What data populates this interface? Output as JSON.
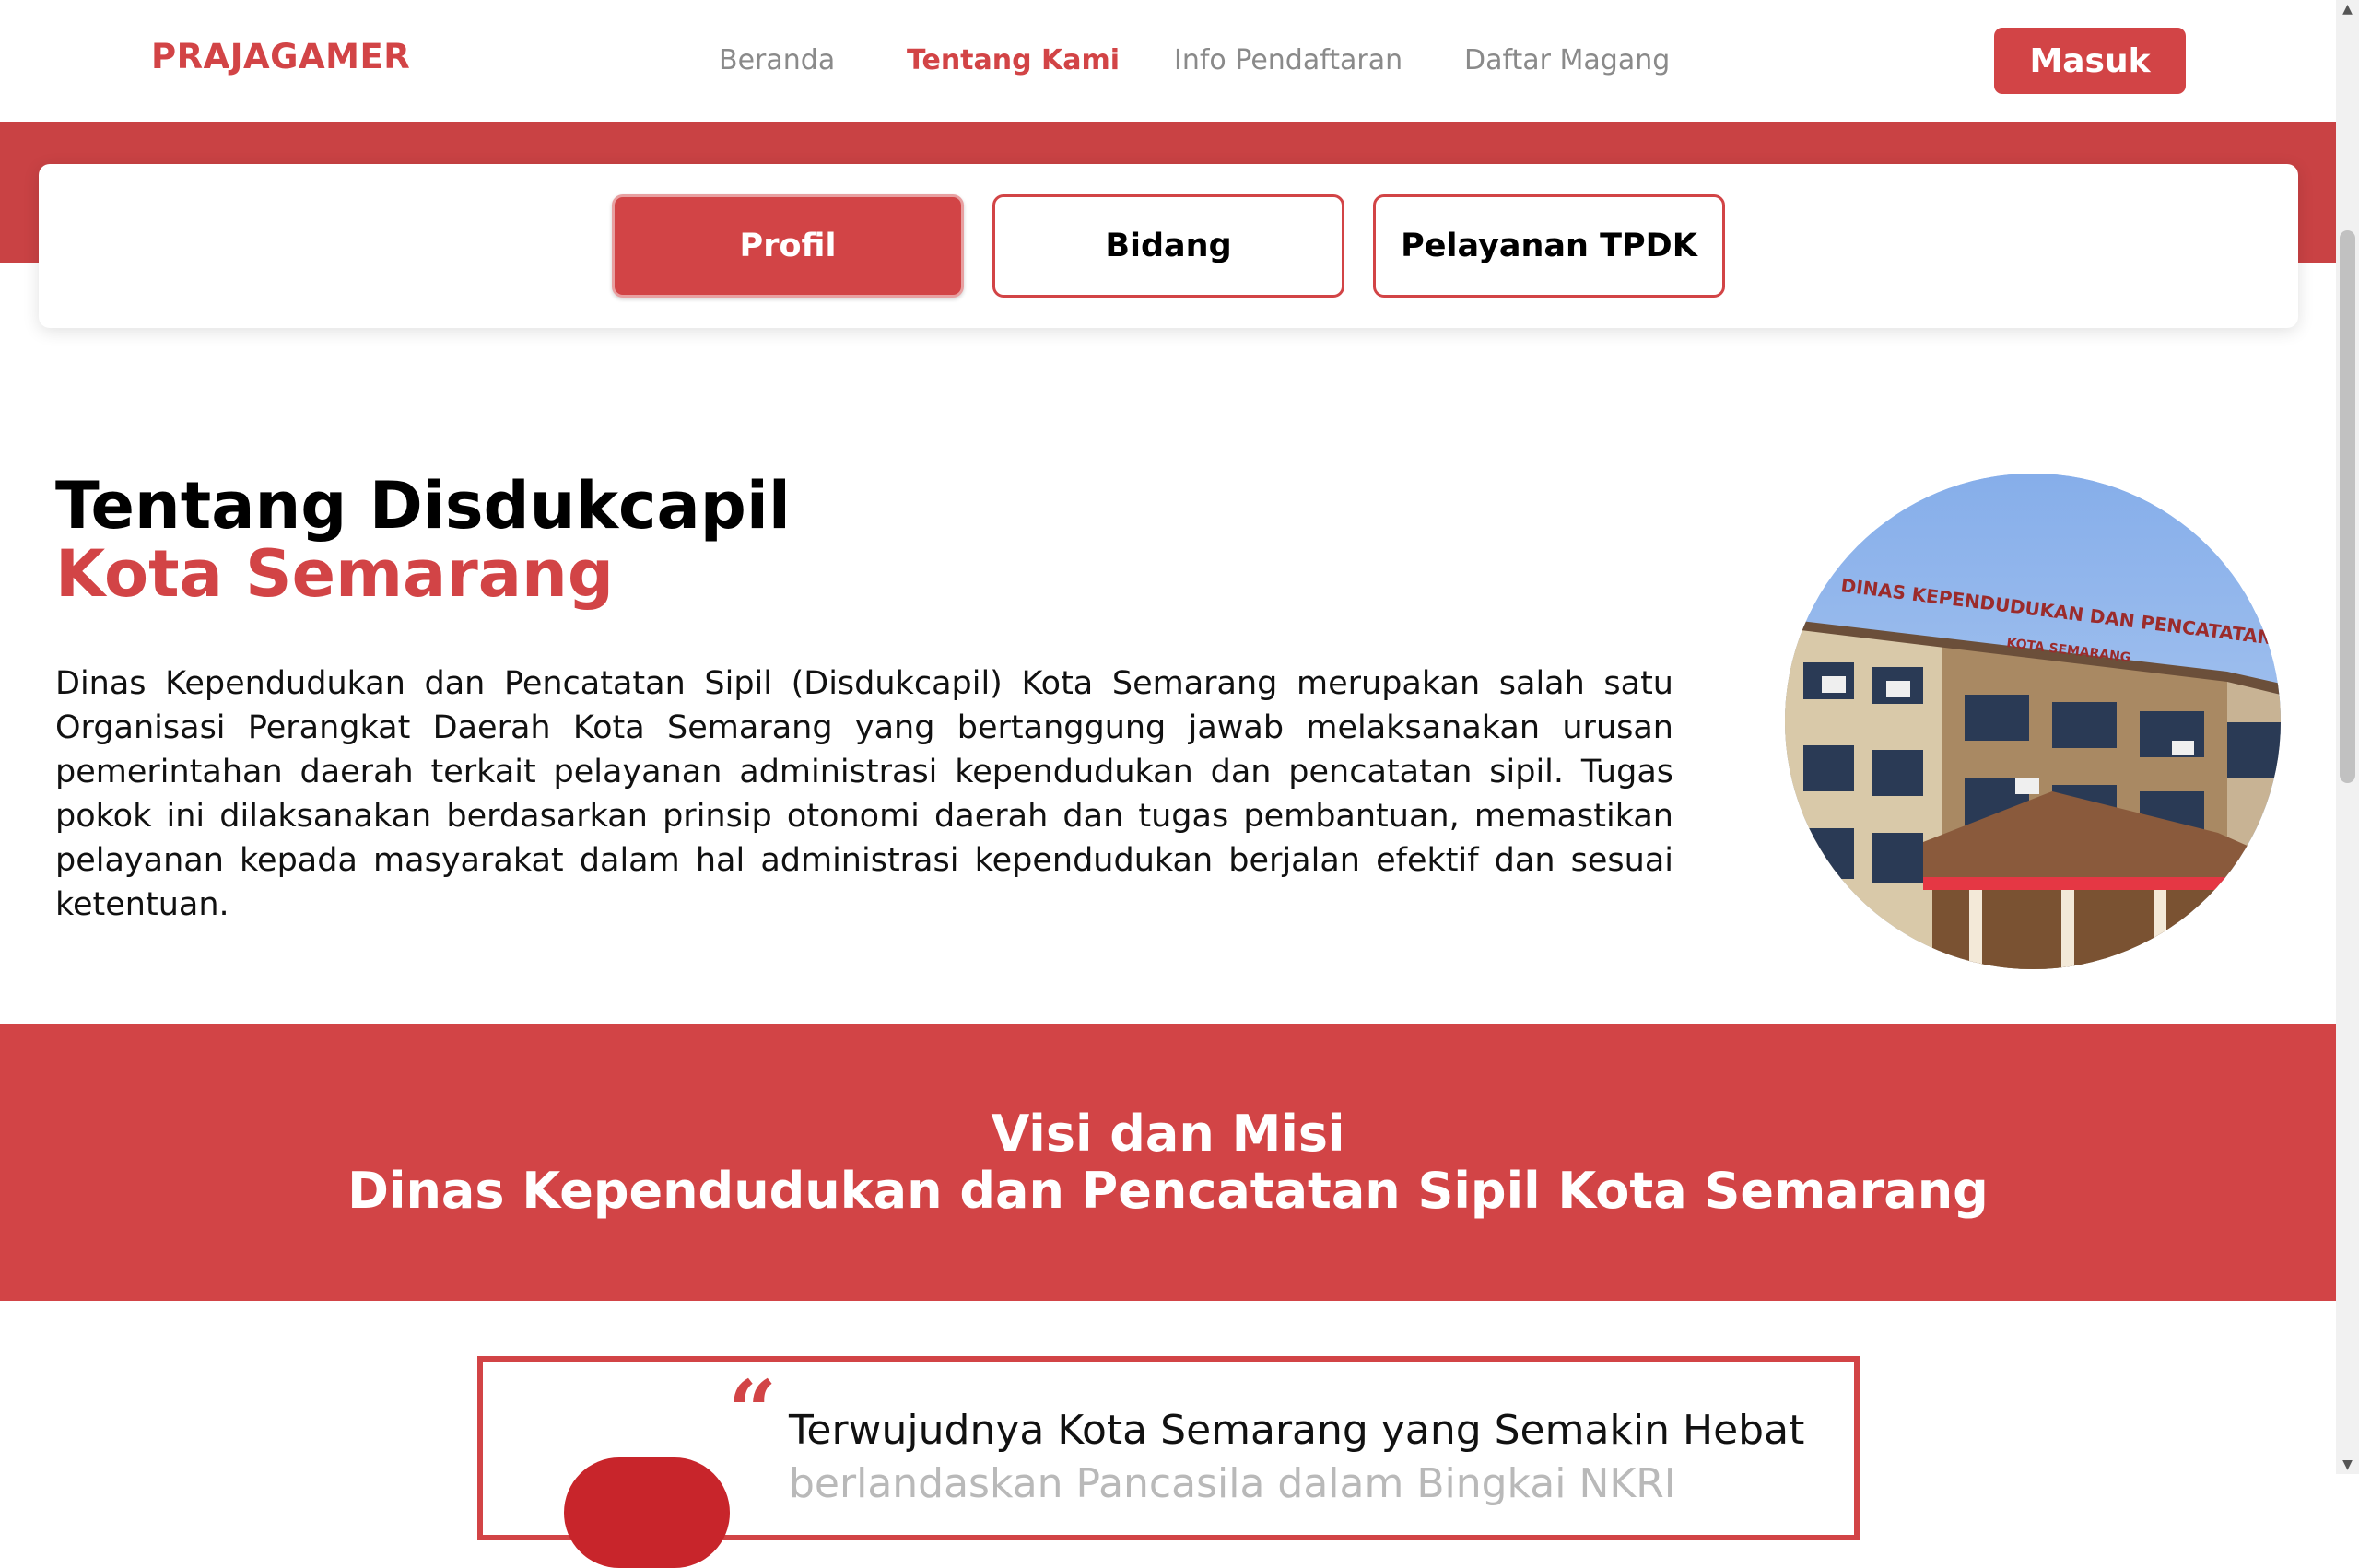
{
  "navbar": {
    "brand": "PRAJAGAMER",
    "links": [
      "Beranda",
      "Tentang Kami",
      "Info Pendaftaran",
      "Daftar Magang"
    ],
    "active": "Tentang Kami",
    "login_label": "Masuk"
  },
  "tabs": [
    {
      "label": "Profil",
      "active": true
    },
    {
      "label": "Bidang",
      "active": false
    },
    {
      "label": "Pelayanan TPDK",
      "active": false
    }
  ],
  "about": {
    "title_line1": "Tentang Disdukcapil",
    "title_line2": "Kota Semarang",
    "body": "Dinas Kependudukan dan Pencatatan Sipil (Disdukcapil) Kota Semarang merupakan salah satu Organisasi Perangkat Daerah Kota Semarang yang bertanggung jawab melaksanakan urusan pemerintahan daerah terkait pelayanan administrasi kependudukan dan pencatatan sipil. Tugas pokok ini dilaksanakan berdasarkan prinsip otonomi daerah dan tugas pembantuan, memastikan pelayanan kepada masyarakat dalam hal administrasi kependudukan berjalan efektif dan sesuai ketentuan.",
    "photo_sign_line1": "DINAS KEPENDUDUKAN DAN PENCATATAN SIPIL",
    "photo_sign_line2": "KOTA SEMARANG"
  },
  "visi_misi": {
    "title_line1": "Visi dan Misi",
    "title_line2": "Dinas Kependudukan dan Pencatatan Sipil Kota Semarang",
    "quote_mark": "“",
    "visi_line1": "Terwujudnya Kota Semarang yang Semakin Hebat",
    "visi_line2_partial": "berlandaskan Pancasila dalam Bingkai NKRI"
  },
  "colors": {
    "brand_red": "#D24446",
    "band_red": "#C94244",
    "text": "#111111",
    "nav_muted": "#8A8A8A"
  }
}
